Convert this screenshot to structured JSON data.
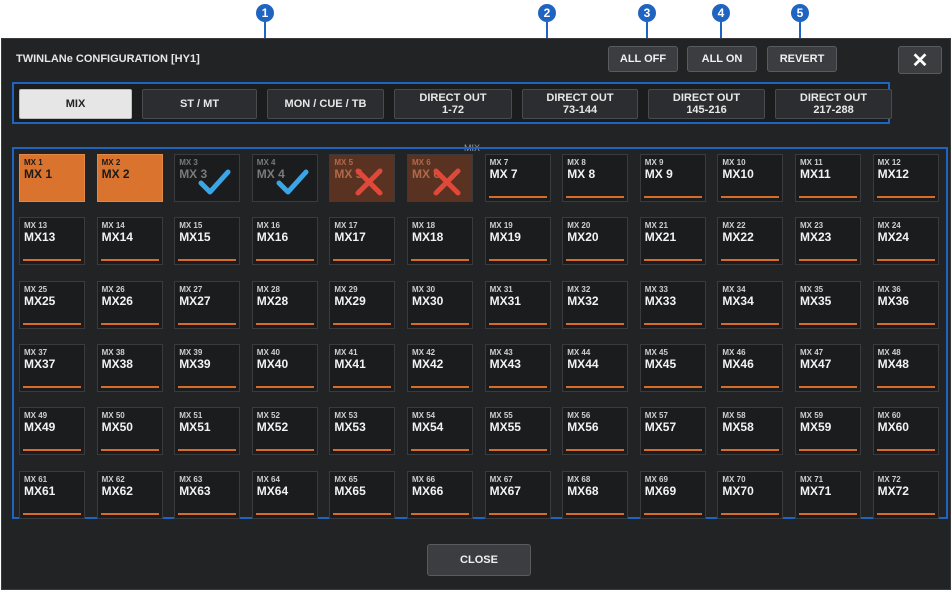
{
  "window": {
    "title": "TWINLANe CONFIGURATION [HY1]"
  },
  "callouts": [
    "1",
    "2",
    "3",
    "4",
    "5"
  ],
  "header_buttons": {
    "all_off": "ALL OFF",
    "all_on": "ALL ON",
    "revert": "REVERT",
    "close_icon": "✕"
  },
  "tabs": [
    {
      "line1": "MIX",
      "line2": "",
      "active": true
    },
    {
      "line1": "ST / MT",
      "line2": "",
      "active": false
    },
    {
      "line1": "MON / CUE / TB",
      "line2": "",
      "active": false
    },
    {
      "line1": "DIRECT OUT",
      "line2": "1-72",
      "active": false
    },
    {
      "line1": "DIRECT OUT",
      "line2": "73-144",
      "active": false
    },
    {
      "line1": "DIRECT OUT",
      "line2": "145-216",
      "active": false
    },
    {
      "line1": "DIRECT OUT",
      "line2": "217-288",
      "active": false
    }
  ],
  "section_label": "MIX",
  "tiles": [
    {
      "small": "MX 1",
      "big": "MX 1",
      "state": "orange"
    },
    {
      "small": "MX 2",
      "big": "MX 2",
      "state": "orange"
    },
    {
      "small": "MX 3",
      "big": "MX 3",
      "state": "check"
    },
    {
      "small": "MX 4",
      "big": "MX 4",
      "state": "check"
    },
    {
      "small": "MX 5",
      "big": "MX 5",
      "state": "cross"
    },
    {
      "small": "MX 6",
      "big": "MX 6",
      "state": "cross"
    },
    {
      "small": "MX 7",
      "big": "MX 7",
      "state": "normal"
    },
    {
      "small": "MX 8",
      "big": "MX 8",
      "state": "normal"
    },
    {
      "small": "MX 9",
      "big": "MX 9",
      "state": "normal"
    },
    {
      "small": "MX 10",
      "big": "MX10",
      "state": "normal"
    },
    {
      "small": "MX 11",
      "big": "MX11",
      "state": "normal"
    },
    {
      "small": "MX 12",
      "big": "MX12",
      "state": "normal"
    },
    {
      "small": "MX 13",
      "big": "MX13",
      "state": "normal"
    },
    {
      "small": "MX 14",
      "big": "MX14",
      "state": "normal"
    },
    {
      "small": "MX 15",
      "big": "MX15",
      "state": "normal"
    },
    {
      "small": "MX 16",
      "big": "MX16",
      "state": "normal"
    },
    {
      "small": "MX 17",
      "big": "MX17",
      "state": "normal"
    },
    {
      "small": "MX 18",
      "big": "MX18",
      "state": "normal"
    },
    {
      "small": "MX 19",
      "big": "MX19",
      "state": "normal"
    },
    {
      "small": "MX 20",
      "big": "MX20",
      "state": "normal"
    },
    {
      "small": "MX 21",
      "big": "MX21",
      "state": "normal"
    },
    {
      "small": "MX 22",
      "big": "MX22",
      "state": "normal"
    },
    {
      "small": "MX 23",
      "big": "MX23",
      "state": "normal"
    },
    {
      "small": "MX 24",
      "big": "MX24",
      "state": "normal"
    },
    {
      "small": "MX 25",
      "big": "MX25",
      "state": "normal"
    },
    {
      "small": "MX 26",
      "big": "MX26",
      "state": "normal"
    },
    {
      "small": "MX 27",
      "big": "MX27",
      "state": "normal"
    },
    {
      "small": "MX 28",
      "big": "MX28",
      "state": "normal"
    },
    {
      "small": "MX 29",
      "big": "MX29",
      "state": "normal"
    },
    {
      "small": "MX 30",
      "big": "MX30",
      "state": "normal"
    },
    {
      "small": "MX 31",
      "big": "MX31",
      "state": "normal"
    },
    {
      "small": "MX 32",
      "big": "MX32",
      "state": "normal"
    },
    {
      "small": "MX 33",
      "big": "MX33",
      "state": "normal"
    },
    {
      "small": "MX 34",
      "big": "MX34",
      "state": "normal"
    },
    {
      "small": "MX 35",
      "big": "MX35",
      "state": "normal"
    },
    {
      "small": "MX 36",
      "big": "MX36",
      "state": "normal"
    },
    {
      "small": "MX 37",
      "big": "MX37",
      "state": "normal"
    },
    {
      "small": "MX 38",
      "big": "MX38",
      "state": "normal"
    },
    {
      "small": "MX 39",
      "big": "MX39",
      "state": "normal"
    },
    {
      "small": "MX 40",
      "big": "MX40",
      "state": "normal"
    },
    {
      "small": "MX 41",
      "big": "MX41",
      "state": "normal"
    },
    {
      "small": "MX 42",
      "big": "MX42",
      "state": "normal"
    },
    {
      "small": "MX 43",
      "big": "MX43",
      "state": "normal"
    },
    {
      "small": "MX 44",
      "big": "MX44",
      "state": "normal"
    },
    {
      "small": "MX 45",
      "big": "MX45",
      "state": "normal"
    },
    {
      "small": "MX 46",
      "big": "MX46",
      "state": "normal"
    },
    {
      "small": "MX 47",
      "big": "MX47",
      "state": "normal"
    },
    {
      "small": "MX 48",
      "big": "MX48",
      "state": "normal"
    },
    {
      "small": "MX 49",
      "big": "MX49",
      "state": "normal"
    },
    {
      "small": "MX 50",
      "big": "MX50",
      "state": "normal"
    },
    {
      "small": "MX 51",
      "big": "MX51",
      "state": "normal"
    },
    {
      "small": "MX 52",
      "big": "MX52",
      "state": "normal"
    },
    {
      "small": "MX 53",
      "big": "MX53",
      "state": "normal"
    },
    {
      "small": "MX 54",
      "big": "MX54",
      "state": "normal"
    },
    {
      "small": "MX 55",
      "big": "MX55",
      "state": "normal"
    },
    {
      "small": "MX 56",
      "big": "MX56",
      "state": "normal"
    },
    {
      "small": "MX 57",
      "big": "MX57",
      "state": "normal"
    },
    {
      "small": "MX 58",
      "big": "MX58",
      "state": "normal"
    },
    {
      "small": "MX 59",
      "big": "MX59",
      "state": "normal"
    },
    {
      "small": "MX 60",
      "big": "MX60",
      "state": "normal"
    },
    {
      "small": "MX 61",
      "big": "MX61",
      "state": "normal"
    },
    {
      "small": "MX 62",
      "big": "MX62",
      "state": "normal"
    },
    {
      "small": "MX 63",
      "big": "MX63",
      "state": "normal"
    },
    {
      "small": "MX 64",
      "big": "MX64",
      "state": "normal"
    },
    {
      "small": "MX 65",
      "big": "MX65",
      "state": "normal"
    },
    {
      "small": "MX 66",
      "big": "MX66",
      "state": "normal"
    },
    {
      "small": "MX 67",
      "big": "MX67",
      "state": "normal"
    },
    {
      "small": "MX 68",
      "big": "MX68",
      "state": "normal"
    },
    {
      "small": "MX 69",
      "big": "MX69",
      "state": "normal"
    },
    {
      "small": "MX 70",
      "big": "MX70",
      "state": "normal"
    },
    {
      "small": "MX 71",
      "big": "MX71",
      "state": "normal"
    },
    {
      "small": "MX 72",
      "big": "MX72",
      "state": "normal"
    }
  ],
  "footer": {
    "close_label": "CLOSE"
  },
  "colors": {
    "callout": "#1f64c0",
    "tile_orange": "#d9732e",
    "check": "#3aa6e8",
    "cross": "#e0483a"
  }
}
